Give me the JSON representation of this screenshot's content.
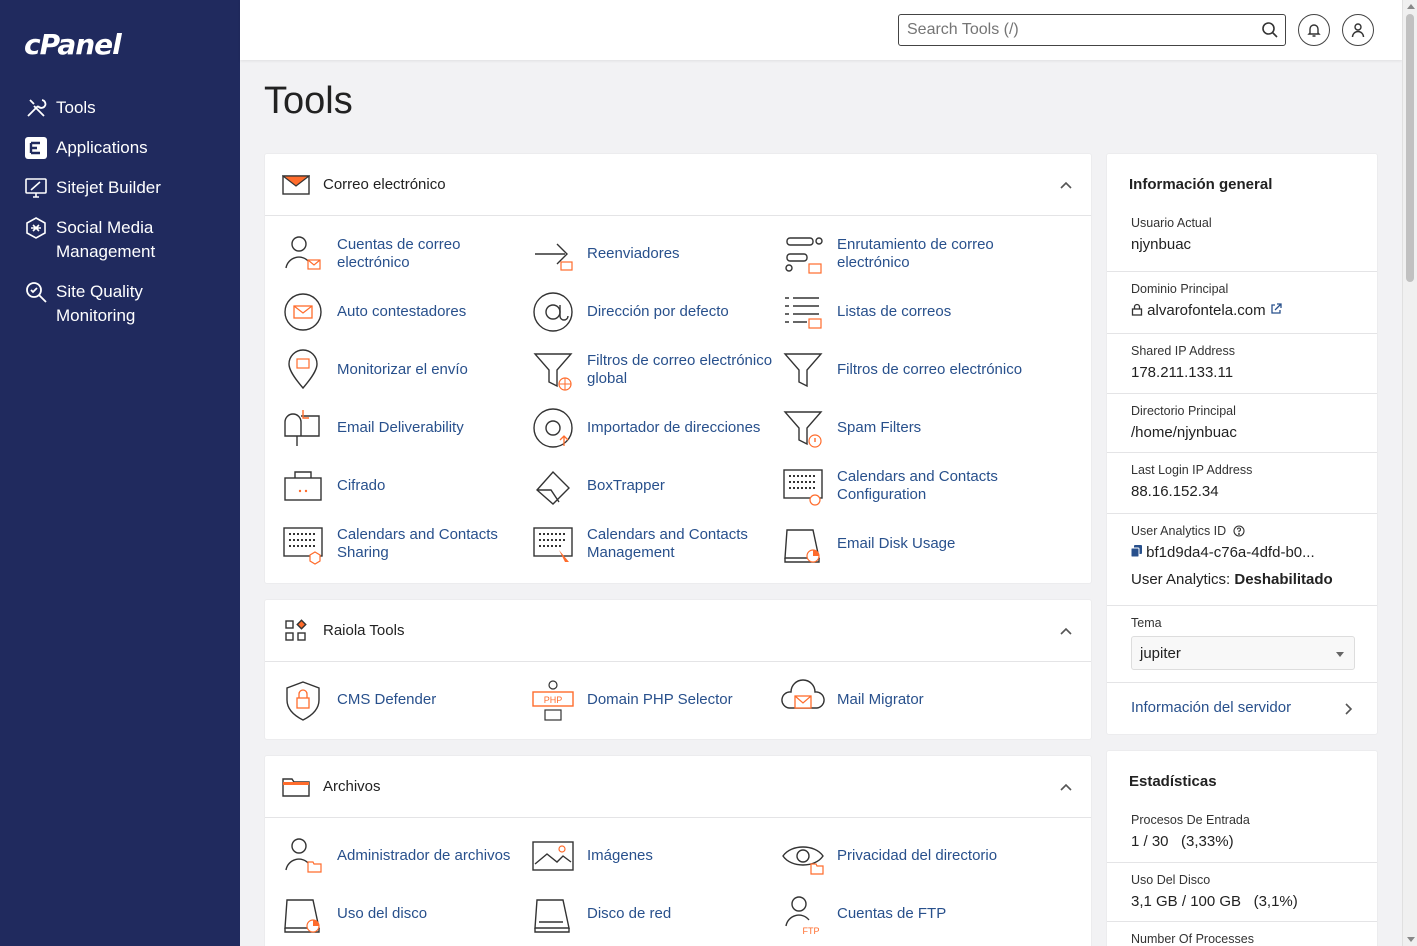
{
  "brand": {
    "logo": "cPanel"
  },
  "sidebar": {
    "items": [
      {
        "label": "Tools",
        "icon": "tools-icon"
      },
      {
        "label": "Applications",
        "icon": "applications-icon"
      },
      {
        "label": "Sitejet Builder",
        "icon": "sitejet-icon"
      },
      {
        "label": "Social Media Management",
        "icon": "social-media-icon"
      },
      {
        "label": "Site Quality Monitoring",
        "icon": "site-quality-icon"
      }
    ]
  },
  "topbar": {
    "search_placeholder": "Search Tools (/)"
  },
  "page": {
    "title": "Tools"
  },
  "sections": [
    {
      "title": "Correo electrónico",
      "tools": [
        "Cuentas de correo electrónico",
        "Reenviadores",
        "Enrutamiento de correo electrónico",
        "Auto contestadores",
        "Dirección por defecto",
        "Listas de correos",
        "Monitorizar el envío",
        "Filtros de correo electrónico global",
        "Filtros de correo electrónico",
        "Email Deliverability",
        "Importador de direcciones",
        "Spam Filters",
        "Cifrado",
        "BoxTrapper",
        "Calendars and Contacts Configuration",
        "Calendars and Contacts Sharing",
        "Calendars and Contacts Management",
        "Email Disk Usage"
      ]
    },
    {
      "title": "Raiola Tools",
      "tools": [
        "CMS Defender",
        "Domain PHP Selector",
        "Mail Migrator"
      ]
    },
    {
      "title": "Archivos",
      "tools": [
        "Administrador de archivos",
        "Imágenes",
        "Privacidad del directorio",
        "Uso del disco",
        "Disco de red",
        "Cuentas de FTP"
      ]
    }
  ],
  "general_info": {
    "title": "Información general",
    "current_user_label": "Usuario Actual",
    "current_user": "njynbuac",
    "main_domain_label": "Dominio Principal",
    "main_domain": "alvarofontela.com",
    "shared_ip_label": "Shared IP Address",
    "shared_ip": "178.211.133.11",
    "home_dir_label": "Directorio Principal",
    "home_dir": "/home/njynbuac",
    "last_login_label": "Last Login IP Address",
    "last_login": "88.16.152.34",
    "analytics_id_label": "User Analytics ID",
    "analytics_id": "bf1d9da4-c76a-4dfd-b0...",
    "analytics_status_label": "User Analytics:",
    "analytics_status": "Deshabilitado",
    "theme_label": "Tema",
    "theme_value": "jupiter",
    "server_info_link": "Información del servidor"
  },
  "stats": {
    "title": "Estadísticas",
    "items": [
      {
        "label": "Procesos De Entrada",
        "value": "1 / 30",
        "pct": "(3,33%)"
      },
      {
        "label": "Uso Del Disco",
        "value": "3,1 GB / 100 GB",
        "pct": "(3,1%)"
      },
      {
        "label": "Number Of Processes",
        "value": "",
        "pct": ""
      }
    ]
  },
  "colors": {
    "sidebar": "#202a5e",
    "accent": "#ff6c2c",
    "link": "#28508c"
  }
}
